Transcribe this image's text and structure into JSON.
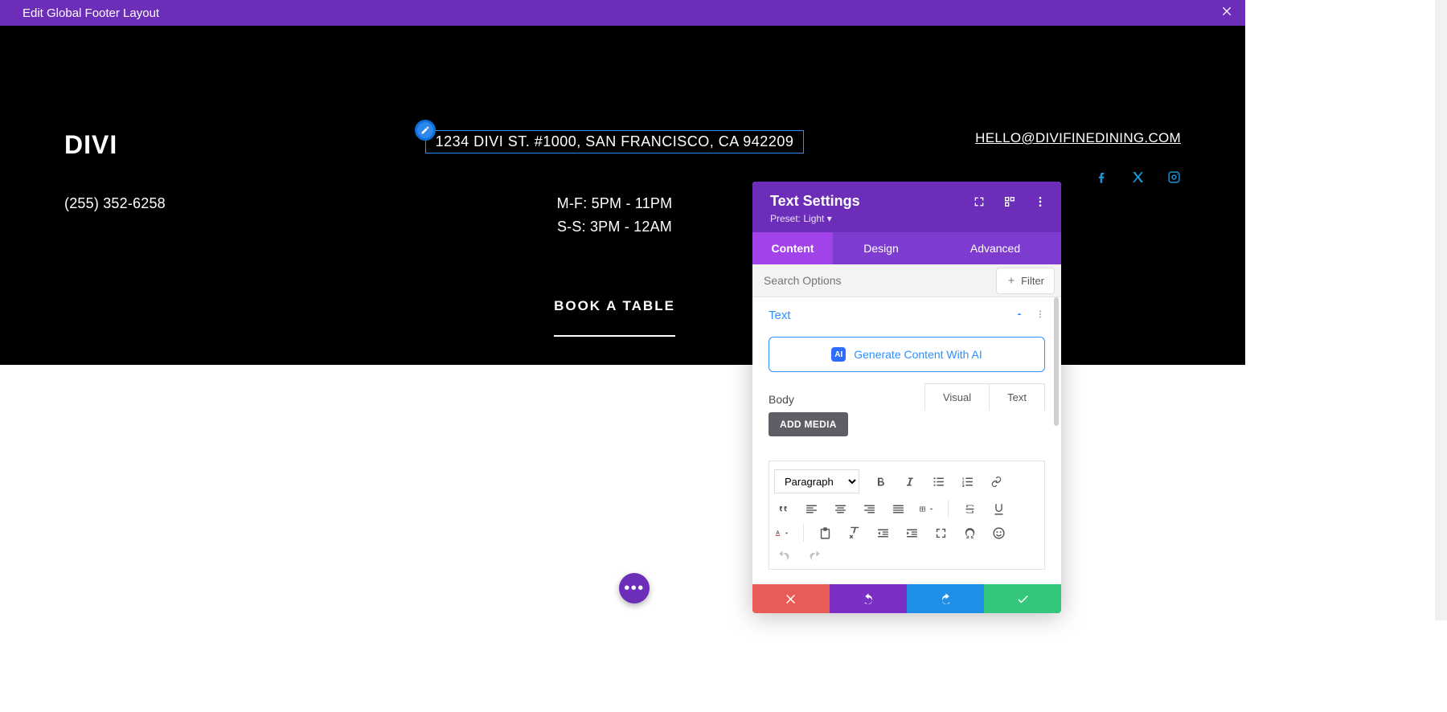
{
  "top_bar": {
    "title": "Edit Global Footer Layout"
  },
  "footer": {
    "logo": "DIVI",
    "phone": "(255) 352-6258",
    "address": "1234 DIVI ST. #1000, SAN FRANCISCO, CA 942209",
    "hours_weekday": "M-F: 5PM - 11PM",
    "hours_weekend": "S-S: 3PM - 12AM",
    "cta": "BOOK A TABLE",
    "email": "HELLO@DIVIFINEDINING.COM"
  },
  "panel": {
    "title": "Text Settings",
    "preset": "Preset: Light ▾",
    "tabs": {
      "content": "Content",
      "design": "Design",
      "advanced": "Advanced"
    },
    "search_placeholder": "Search Options",
    "filter_label": "Filter",
    "section_title": "Text",
    "ai_button": "Generate Content With AI",
    "ai_badge": "AI",
    "body_label": "Body",
    "add_media": "ADD MEDIA",
    "editor_tabs": {
      "visual": "Visual",
      "text": "Text"
    },
    "paragraph_select": "Paragraph"
  }
}
